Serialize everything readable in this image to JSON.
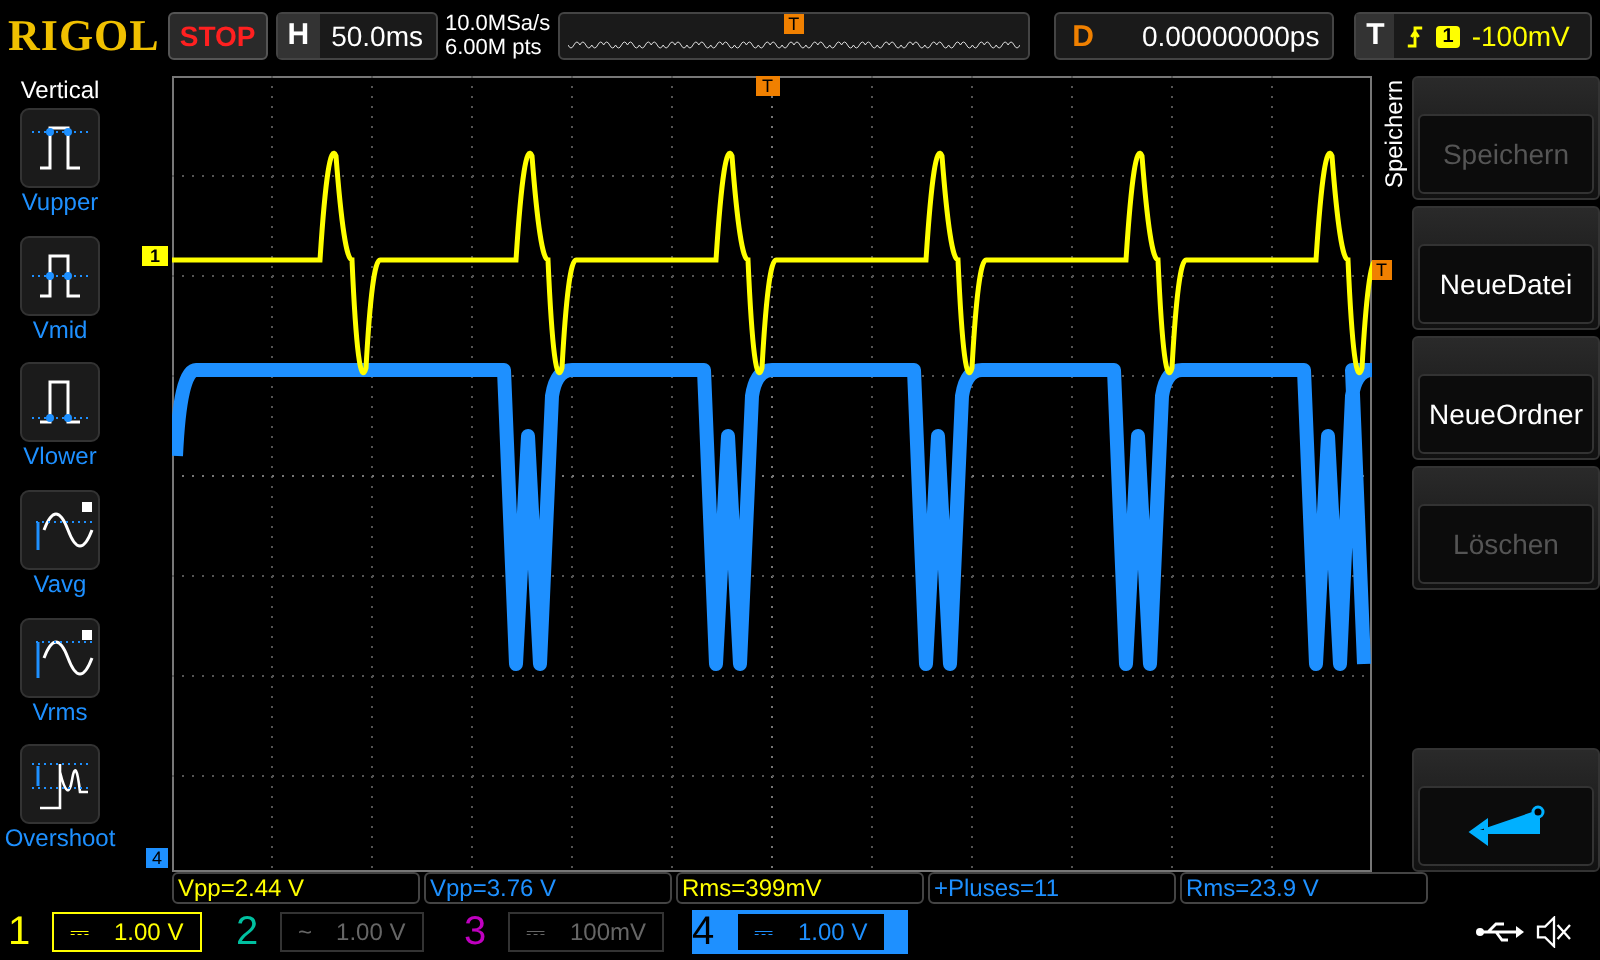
{
  "header": {
    "logo": "RIGOL",
    "run_state": "STOP",
    "horizontal": {
      "label": "H",
      "value": "50.0ms"
    },
    "sample_rate": "10.0MSa/s",
    "memory_depth": "6.00M pts",
    "trigger_marker": "T",
    "delay": {
      "label": "D",
      "value": "0.00000000ps"
    },
    "trigger": {
      "label": "T",
      "source": "1",
      "level": "-100mV"
    }
  },
  "left_menu": {
    "title": "Vertical",
    "items": [
      {
        "label": "Vupper",
        "kind": "upper"
      },
      {
        "label": "Vmid",
        "kind": "mid"
      },
      {
        "label": "Vlower",
        "kind": "lower"
      },
      {
        "label": "Vavg",
        "kind": "avg"
      },
      {
        "label": "Vrms",
        "kind": "rms"
      },
      {
        "label": "Overshoot",
        "kind": "overshoot"
      }
    ]
  },
  "screen": {
    "channel_marker": "1",
    "trigger_top": "T",
    "trigger_right": "T",
    "channel4_marker": "4"
  },
  "right_menu": {
    "title": "Speichern",
    "buttons": [
      {
        "label": "Speichern",
        "disabled": true,
        "kind": "text"
      },
      {
        "label": "NeueDatei",
        "disabled": false,
        "kind": "text"
      },
      {
        "label": "NeueOrdner",
        "disabled": false,
        "kind": "text"
      },
      {
        "label": "Löschen",
        "disabled": true,
        "kind": "text"
      },
      {
        "kind": "spacer"
      },
      {
        "kind": "back"
      }
    ]
  },
  "measurements": [
    {
      "text": "Vpp=2.44 V",
      "color": "#ffff00"
    },
    {
      "text": "Vpp=3.76 V",
      "color": "#1e90ff"
    },
    {
      "text": "Rms=399mV",
      "color": "#ffff00"
    },
    {
      "text": "+Pluses=11",
      "color": "#1e90ff"
    },
    {
      "text": "Rms=23.9 V",
      "color": "#1e90ff"
    }
  ],
  "channels": [
    {
      "number": "1",
      "coupling": "⎓",
      "scale": "1.00 V",
      "on": true,
      "selected": false,
      "color": "#ffff00"
    },
    {
      "number": "2",
      "coupling": "~",
      "scale": "1.00 V",
      "on": false,
      "selected": false,
      "color": "#00c0a0"
    },
    {
      "number": "3",
      "coupling": "⎓",
      "scale": "100mV",
      "on": false,
      "selected": false,
      "color": "#c000c0"
    },
    {
      "number": "4",
      "coupling": "⎓",
      "scale": "1.00 V",
      "on": true,
      "selected": true,
      "color": "#1e90ff"
    }
  ]
}
